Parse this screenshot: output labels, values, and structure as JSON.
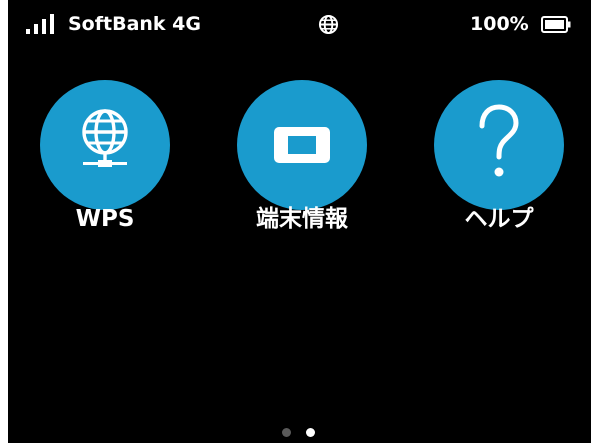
{
  "status_bar": {
    "carrier": "SoftBank 4G",
    "battery_percent": "100%",
    "signal_icon": "signal-bars-icon",
    "network_icon": "globe-icon",
    "battery_icon": "battery-full-icon"
  },
  "apps": [
    {
      "label": "WPS",
      "icon": "network-globe-icon"
    },
    {
      "label": "端末情報",
      "icon": "device-info-icon"
    },
    {
      "label": "ヘルプ",
      "icon": "question-mark-icon"
    }
  ],
  "pager": {
    "page_count": 2,
    "current_page": 2
  },
  "colors": {
    "background": "#000000",
    "app_circle": "#1a9bcd",
    "text": "#ffffff",
    "pager_active": "#ffffff",
    "pager_inactive": "#5a5a5a"
  }
}
